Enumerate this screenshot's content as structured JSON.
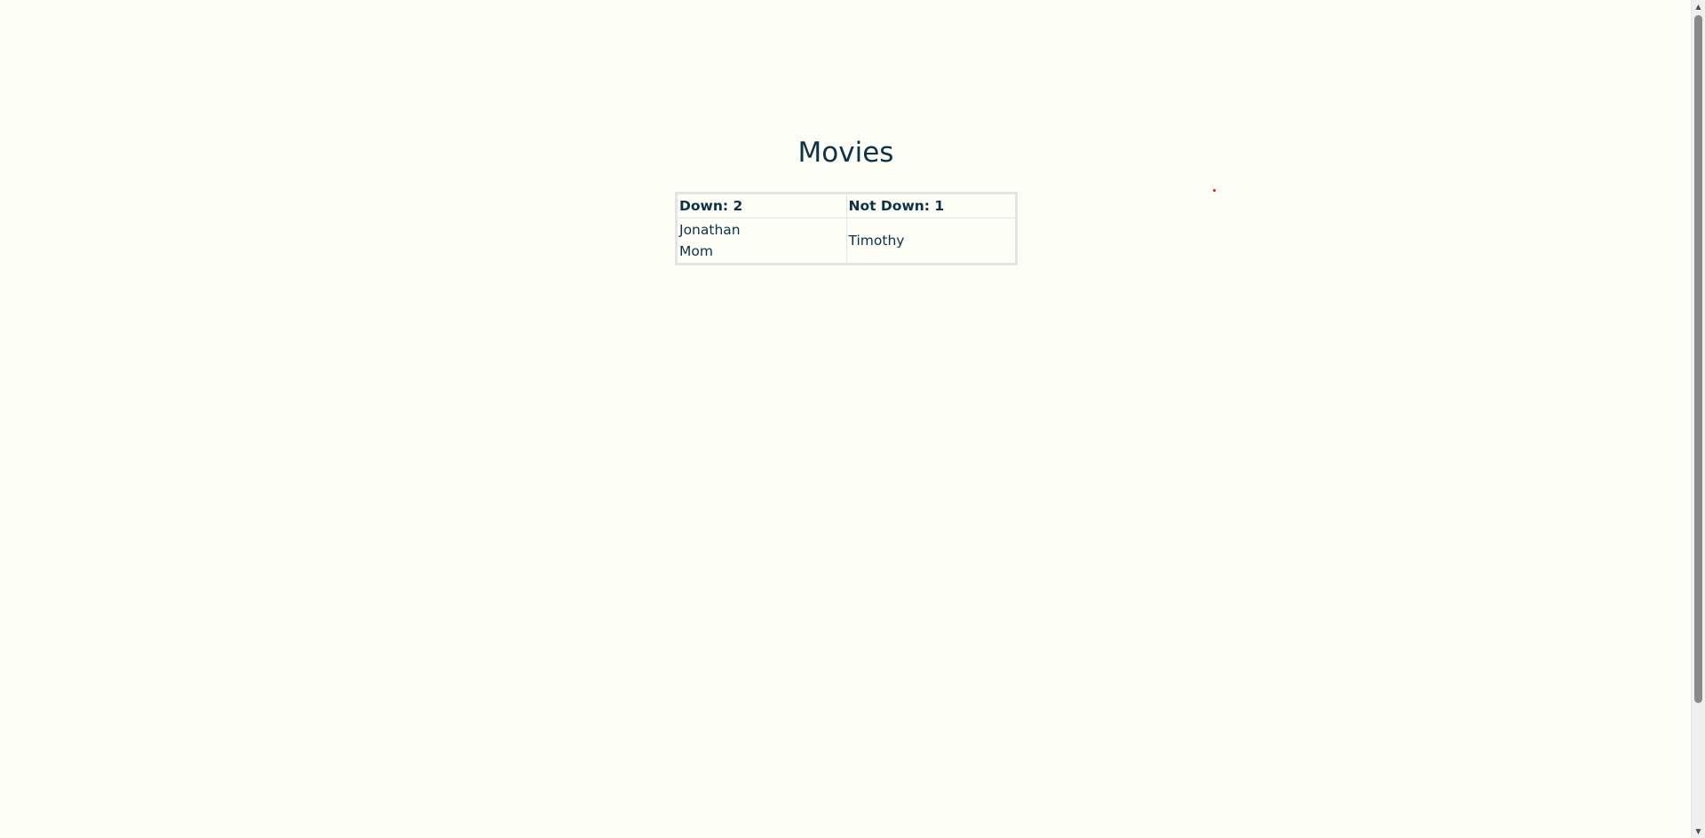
{
  "page": {
    "title": "Movies"
  },
  "vote_table": {
    "headers": {
      "down": "Down: 2",
      "not_down": "Not Down: 1"
    },
    "down_names": [
      "Jonathan",
      "Mom"
    ],
    "not_down_names": [
      "Timothy"
    ]
  },
  "scrollbar": {
    "up_icon": "▲",
    "down_icon": "▼"
  },
  "colors": {
    "background": "#fdfef6",
    "text": "#0d3248",
    "table_border": "#e2e4e6",
    "dot": "#d81e1e"
  }
}
